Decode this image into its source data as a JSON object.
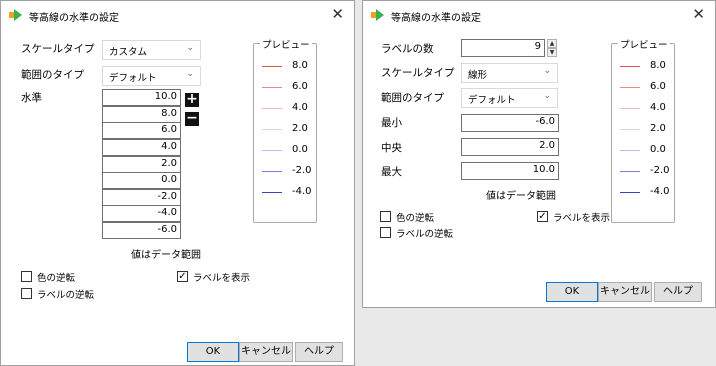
{
  "colors": {
    "red": "#e0505a",
    "red_light": "#f0a0a8",
    "neutral": "#d8d8d8",
    "blue_light": "#a8b0e8",
    "blue": "#5a60d8",
    "blue_dark": "#3038b0",
    "ok_border": "#0078d7"
  },
  "dialog1": {
    "title": "等高線の水準の設定",
    "close_icon": "close-icon",
    "scale_type_label": "スケールタイプ",
    "scale_type_value": "カスタム",
    "range_type_label": "範囲のタイプ",
    "range_type_value": "デフォルト",
    "levels_label": "水準",
    "levels": [
      "10.0",
      "8.0",
      "6.0",
      "4.0",
      "2.0",
      "0.0",
      "-2.0",
      "-4.0",
      "-6.0"
    ],
    "values_note": "値はデータ範囲",
    "reverse_colors_label": "色の逆転",
    "reverse_colors_checked": false,
    "reverse_labels_label": "ラベルの逆転",
    "reverse_labels_checked": false,
    "show_labels_label": "ラベルを表示",
    "show_labels_checked": true,
    "preview_title": "プレビュー",
    "preview_values": [
      "8.0",
      "6.0",
      "4.0",
      "2.0",
      "0.0",
      "-2.0",
      "-4.0"
    ],
    "ok_label": "OK",
    "cancel_label": "キャンセル",
    "help_label": "ヘルプ"
  },
  "dialog2": {
    "title": "等高線の水準の設定",
    "num_labels_label": "ラベルの数",
    "num_labels_value": "9",
    "scale_type_label": "スケールタイプ",
    "scale_type_value": "線形",
    "range_type_label": "範囲のタイプ",
    "range_type_value": "デフォルト",
    "min_label": "最小",
    "min_value": "-6.0",
    "center_label": "中央",
    "center_value": "2.0",
    "max_label": "最大",
    "max_value": "10.0",
    "values_note": "値はデータ範囲",
    "reverse_colors_label": "色の逆転",
    "reverse_colors_checked": false,
    "reverse_labels_label": "ラベルの逆転",
    "reverse_labels_checked": false,
    "show_labels_label": "ラベルを表示",
    "show_labels_checked": true,
    "preview_title": "プレビュー",
    "preview_values": [
      "8.0",
      "6.0",
      "4.0",
      "2.0",
      "0.0",
      "-2.0",
      "-4.0"
    ],
    "ok_label": "OK",
    "cancel_label": "キャンセル",
    "help_label": "ヘルプ"
  },
  "glyphs": {
    "close": "✕",
    "chevron": "⌄",
    "plus": "+",
    "minus": "−",
    "check": "✓",
    "spin_up": "▲",
    "spin_down": "▼"
  }
}
